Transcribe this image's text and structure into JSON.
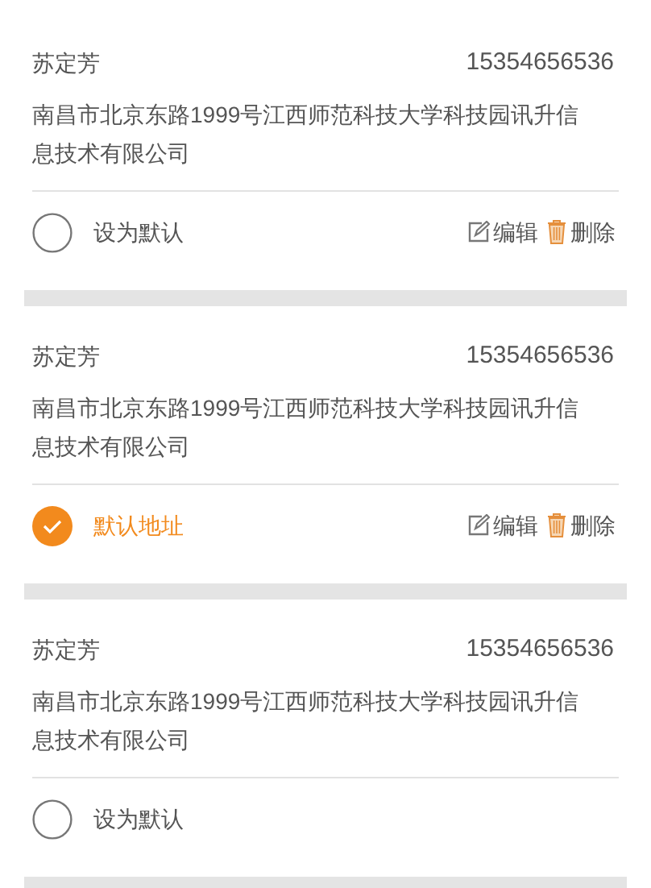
{
  "addresses": [
    {
      "name": "苏定芳",
      "phone": "15354656536",
      "address": "南昌市北京东路1999号江西师范科技大学科技园讯升信息技术有限公司",
      "default_label": "设为默认",
      "selected": false,
      "actions": [
        "编辑",
        "删除"
      ]
    },
    {
      "name": "苏定芳",
      "phone": "15354656536",
      "address": "南昌市北京东路1999号江西师范科技大学科技园讯升信息技术有限公司",
      "default_label": "默认地址",
      "selected": true,
      "actions": [
        "编辑",
        "删除"
      ]
    },
    {
      "name": "苏定芳",
      "phone": "15354656536",
      "address": "南昌市北京东路1999号江西师范科技大学科技园讯升信息技术有限公司",
      "default_label": "设为默认",
      "selected": false
    }
  ]
}
